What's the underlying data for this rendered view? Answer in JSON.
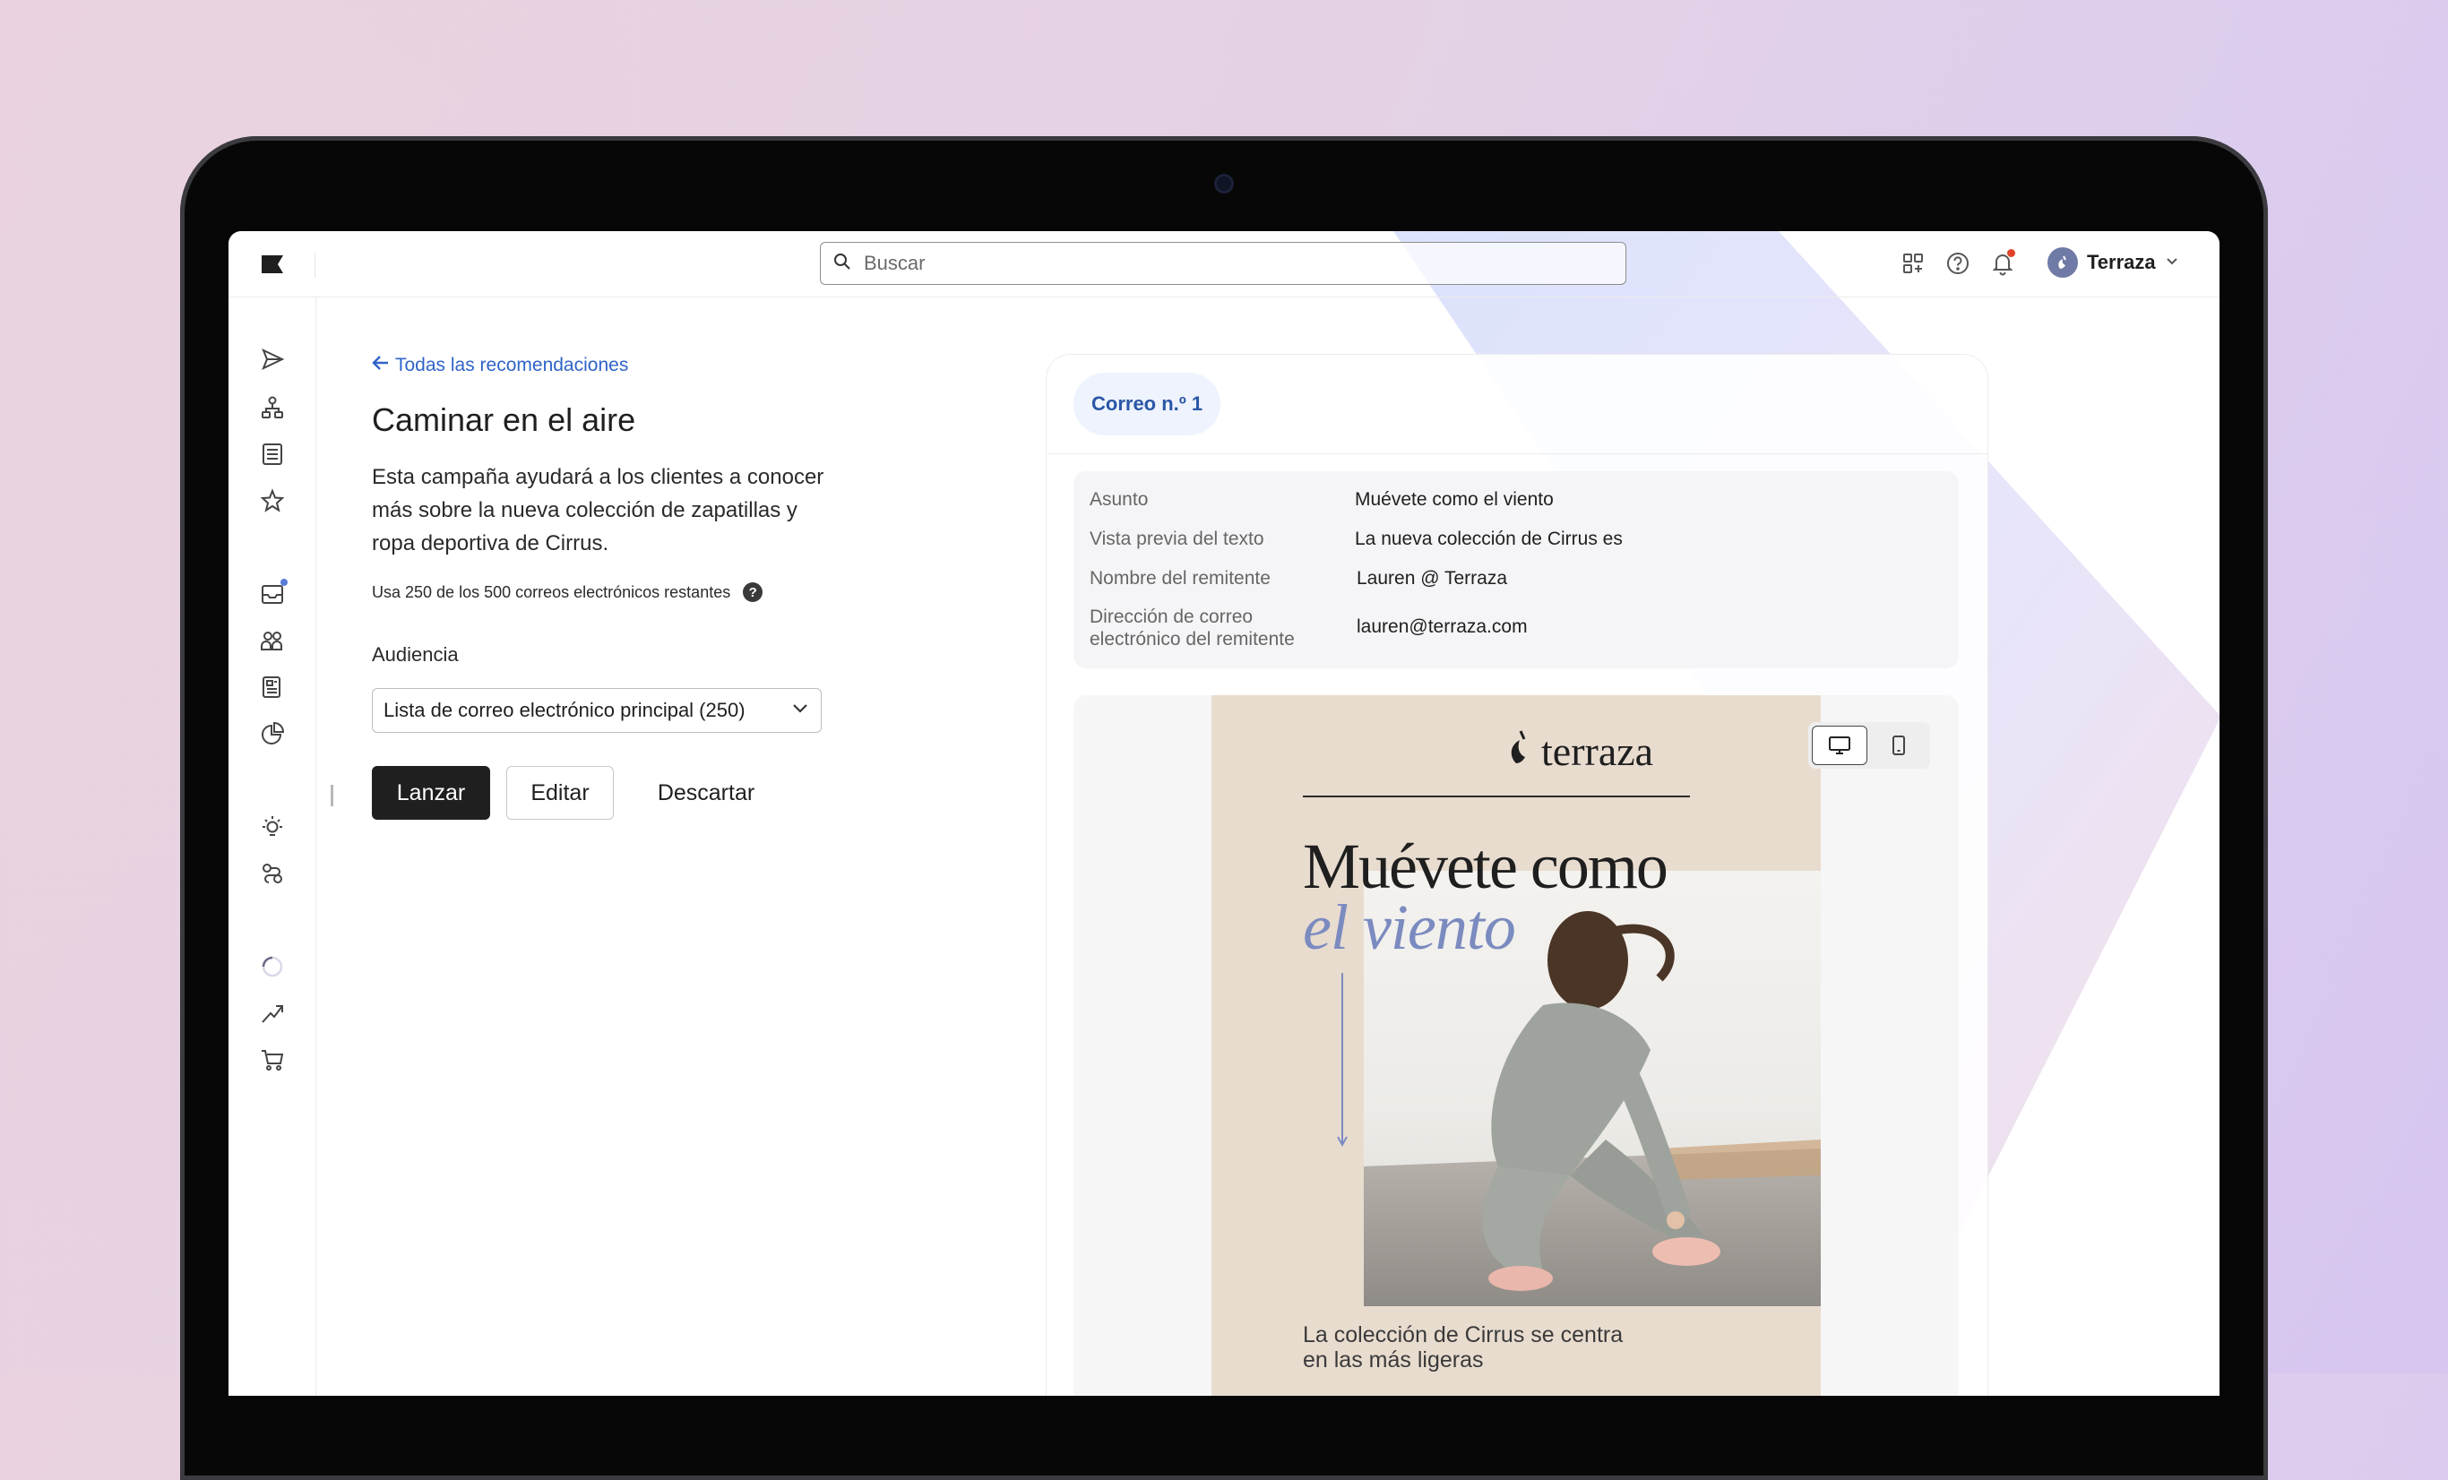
{
  "search": {
    "placeholder": "Buscar"
  },
  "account": {
    "name": "Terraza"
  },
  "icons": {
    "logo": "flag-logo-icon",
    "topbar": [
      "apps-grid-icon",
      "help-icon",
      "bell-icon",
      "chevron-down-icon"
    ],
    "sidebar": [
      "send-icon",
      "org-chart-icon",
      "list-icon",
      "star-icon",
      "inbox-icon",
      "people-icon",
      "content-icon",
      "pie-chart-icon",
      "lightbulb-icon",
      "automation-icon",
      "loading-icon",
      "trend-icon",
      "cart-icon"
    ]
  },
  "colors": {
    "accent": "#2f64c8",
    "primary_button": "#1f1f1f",
    "notification": "#e2432a",
    "headline_accent": "#7b8bc0"
  },
  "campaign": {
    "back_link": "Todas las recomendaciones",
    "title": "Caminar en el aire",
    "description": "Esta campaña ayudará a los clientes a conocer más sobre la nueva colección de zapatillas y ropa deportiva de Cirrus.",
    "usage": "Usa 250 de los 500 correos electrónicos restantes",
    "usage_help": "?",
    "audience_label": "Audiencia",
    "audience_value": "Lista de correo electrónico principal (250)",
    "buttons": {
      "launch": "Lanzar",
      "edit": "Editar",
      "discard": "Descartar"
    }
  },
  "email": {
    "tab": "Correo n.º 1",
    "details": [
      {
        "label": "Asunto",
        "value": "Muévete como el viento"
      },
      {
        "label": "Vista previa del texto",
        "value": "La nueva colección de Cirrus es"
      },
      {
        "label": "Nombre del remitente",
        "value": "Lauren @ Terraza"
      },
      {
        "label": "Dirección de correo electrónico del remitente",
        "value": "lauren@terraza.com"
      }
    ],
    "brand": "terraza",
    "headline_line1": "Muévete como",
    "headline_line2": "el viento",
    "body": "La colección de Cirrus se centra en las más ligeras"
  }
}
